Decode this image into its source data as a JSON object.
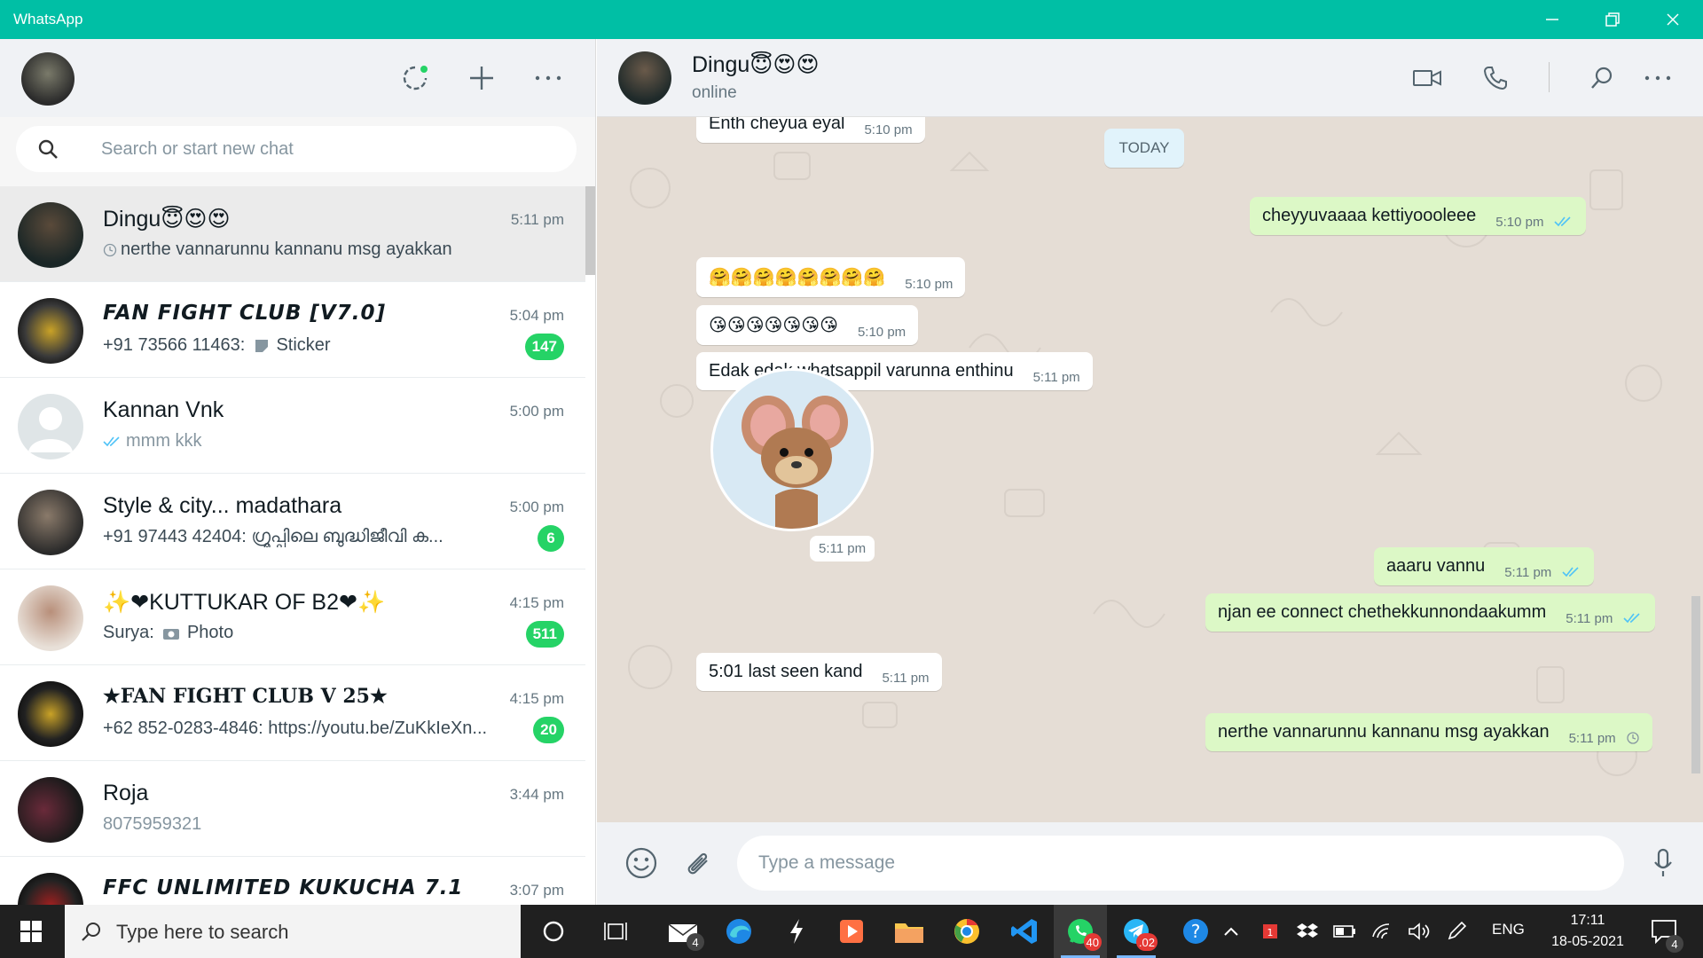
{
  "window": {
    "title": "WhatsApp"
  },
  "left": {
    "search_placeholder": "Search or start new chat",
    "chats": [
      {
        "name": "Dingu😇😍😍",
        "time": "5:11 pm",
        "preview": "nerthe vannarunnu kannanu msg ayakkan",
        "badge": ""
      },
      {
        "name": "FAN FIGHT CLUB [V7.0]",
        "time": "5:04 pm",
        "preview_sender": "+91 73566 11463:",
        "preview": "Sticker",
        "badge": "147"
      },
      {
        "name": "Kannan Vnk",
        "time": "5:00 pm",
        "preview": "mmm kkk",
        "badge": ""
      },
      {
        "name": "Style & city... madathara",
        "time": "5:00 pm",
        "preview": "+91 97443 42404: ഗ്രൂപ്പിലെ ബുദ്ധിജീവി ക...",
        "badge": "6"
      },
      {
        "name": "✨❤KUTTUKAR OF B2❤✨",
        "time": "4:15 pm",
        "preview_sender": "Surya:",
        "preview": "Photo",
        "badge": "511"
      },
      {
        "name": "★FAN FIGHT CLUB V 25★",
        "time": "4:15 pm",
        "preview": "+62 852-0283-4846: https://youtu.be/ZuKkIeXn...",
        "badge": "20"
      },
      {
        "name": "Roja",
        "time": "3:44 pm",
        "preview": "8075959321",
        "badge": ""
      },
      {
        "name": "FFC UNLIMITED KUKUCHA 7.1",
        "time": "3:07 pm",
        "preview": "",
        "badge": ""
      }
    ]
  },
  "conversation": {
    "name": "Dingu😇😍😍",
    "status": "online",
    "day_label": "TODAY",
    "messages": [
      {
        "dir": "in",
        "text": "Enth cheyua eyal",
        "time": "5:10 pm"
      },
      {
        "dir": "out",
        "text": "cheyyuvaaaa kettiyoooleee",
        "time": "5:10 pm",
        "status": "read"
      },
      {
        "dir": "in",
        "text": "🤗🤗🤗🤗🤗🤗🤗🤗",
        "time": "5:10 pm"
      },
      {
        "dir": "in",
        "text": "😘😘😘😘😘😘😘",
        "time": "5:10 pm"
      },
      {
        "dir": "in",
        "text": "Edak edak whatsappil varunna enthinu",
        "time": "5:11 pm"
      },
      {
        "dir": "in",
        "type": "sticker",
        "time": "5:11 pm"
      },
      {
        "dir": "out",
        "text": "aaaru vannu",
        "time": "5:11 pm",
        "status": "read"
      },
      {
        "dir": "out",
        "text": "njan ee connect chethekkunnondaakumm",
        "time": "5:11 pm",
        "status": "read"
      },
      {
        "dir": "in",
        "text": "5:01 last seen kand",
        "time": "5:11 pm"
      },
      {
        "dir": "out",
        "text": "nerthe vannarunnu kannanu msg ayakkan",
        "time": "5:11 pm",
        "status": "pending"
      }
    ],
    "composer_placeholder": "Type a message"
  },
  "taskbar": {
    "search_placeholder": "Type here to search",
    "mail_badge": "4",
    "whatsapp_badge": "40",
    "telegram_badge": ".02",
    "lang": "ENG",
    "time": "17:11",
    "date": "18-05-2021",
    "notification_count": "4"
  },
  "colors": {
    "accent": "#00bfa5",
    "unread": "#25d366",
    "outgoing": "#dcf8c6",
    "read_tick": "#4fc3f7"
  }
}
